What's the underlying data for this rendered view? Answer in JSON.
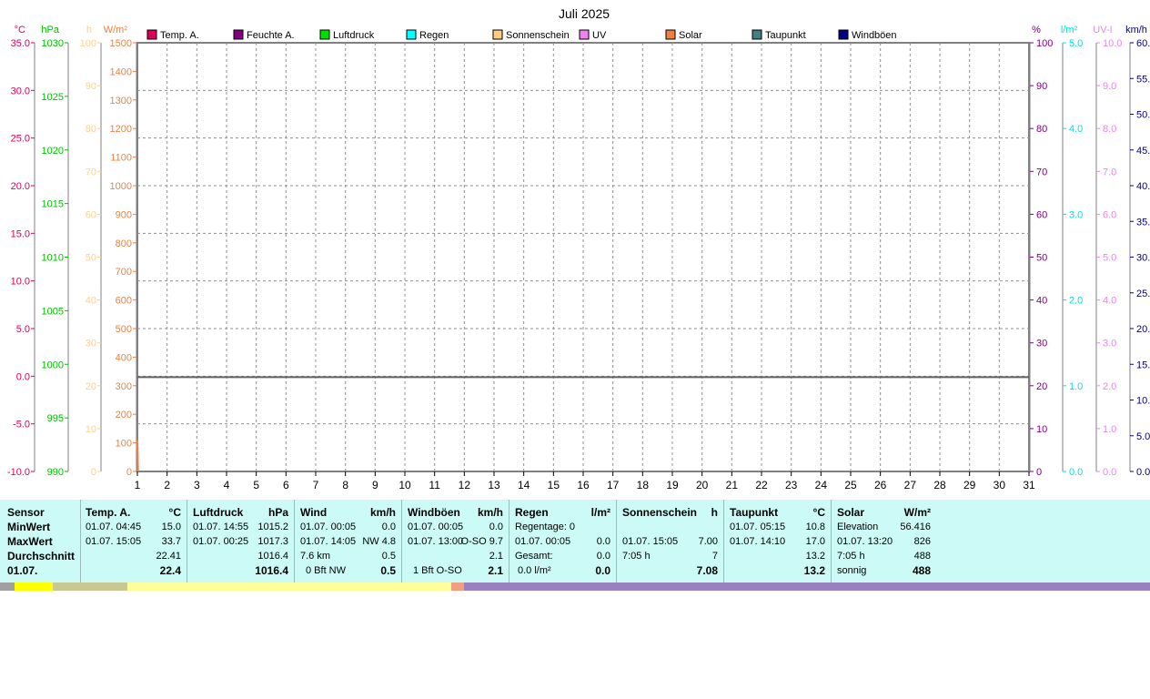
{
  "chart_data": {
    "type": "line",
    "title": "Juli 2025",
    "x": [
      1,
      2,
      3,
      4,
      5,
      6,
      7,
      8,
      9,
      10,
      11,
      12,
      13,
      14,
      15,
      16,
      17,
      18,
      19,
      20,
      21,
      22,
      23,
      24,
      25,
      26,
      27,
      28,
      29,
      30,
      31
    ],
    "xlim": [
      1,
      31
    ],
    "grid": true,
    "legend_position": "top",
    "legend": [
      {
        "name": "Temp. A.",
        "color": "#e0005a"
      },
      {
        "name": "Feuchte A.",
        "color": "#800080"
      },
      {
        "name": "Luftdruck",
        "color": "#00e000"
      },
      {
        "name": "Regen",
        "color": "#00ffff"
      },
      {
        "name": "Sonnenschein",
        "color": "#ffcc80"
      },
      {
        "name": "UV",
        "color": "#ee82ee"
      },
      {
        "name": "Solar",
        "color": "#f08040"
      },
      {
        "name": "Taupunkt",
        "color": "#408080"
      },
      {
        "name": "Windböen",
        "color": "#000080"
      }
    ],
    "axes": [
      {
        "unit": "°C",
        "color": "#e0005a",
        "side": "left",
        "min": -10,
        "max": 35,
        "step": 5,
        "decimals": 1
      },
      {
        "unit": "hPa",
        "color": "#00c000",
        "side": "left",
        "min": 990,
        "max": 1030,
        "step": 5,
        "decimals": 0
      },
      {
        "unit": "h",
        "color": "#ffd090",
        "side": "left",
        "min": 0,
        "max": 100,
        "step": 10,
        "decimals": 0
      },
      {
        "unit": "W/m²",
        "color": "#f08040",
        "side": "left",
        "min": 0,
        "max": 1500,
        "step": 100,
        "decimals": 0
      },
      {
        "unit": "%",
        "color": "#800080",
        "side": "right",
        "min": 0,
        "max": 100,
        "step": 10,
        "decimals": 0
      },
      {
        "unit": "l/m²",
        "color": "#00e0e0",
        "side": "right",
        "min": 0,
        "max": 5,
        "step": 1,
        "decimals": 1
      },
      {
        "unit": "UV-I",
        "color": "#ee82ee",
        "side": "right",
        "min": 0,
        "max": 10,
        "step": 1,
        "decimals": 1
      },
      {
        "unit": "km/h",
        "color": "#000080",
        "side": "right",
        "min": 0,
        "max": 60,
        "step": 5,
        "decimals": 1
      }
    ],
    "series": [
      {
        "name": "Solar",
        "unit": "W/m²",
        "points": [
          [
            1,
            110
          ],
          [
            1.02,
            0
          ]
        ]
      }
    ],
    "reference_value": 330
  },
  "table": {
    "sensor": {
      "header": "Sensor",
      "min": "MinWert",
      "max": "MaxWert",
      "avg": "Durchschnitt",
      "day": "01.07."
    },
    "temp": {
      "title": "Temp. A.",
      "unit": "°C",
      "min_time": "01.07.  04:45",
      "min_val": "15.0",
      "max_time": "01.07.  15:05",
      "max_val": "33.7",
      "avg": "22.41",
      "day": "22.4"
    },
    "pressure": {
      "title": "Luftdruck",
      "unit": "hPa",
      "min_time": "01.07.  14:55",
      "min_val": "1015.2",
      "max_time": "01.07.  00:25",
      "max_val": "1017.3",
      "avg": "1016.4",
      "day": "1016.4"
    },
    "wind": {
      "title": "Wind",
      "unit": "km/h",
      "min_time": "01.07.  00:05",
      "min_val": "0.0",
      "max_time": "01.07.  14:05",
      "max_val": "NW 4.8",
      "avg_label": "7.6 km",
      "avg": "0.5",
      "day_label": "0 Bft NW",
      "day": "0.5"
    },
    "gusts": {
      "title": "Windböen",
      "unit": "km/h",
      "min_time": "01.07.  00:05",
      "min_val": "0.0",
      "max_time": "01.07.  13:00",
      "max_val": "O-SO 9.7",
      "avg": "2.1",
      "day_label": "1 Bft O-SO",
      "day": "2.1"
    },
    "rain": {
      "title": "Regen",
      "unit": "l/m²",
      "min_label": "Regentage: 0",
      "max_time": "01.07.  00:05",
      "max_val": "0.0",
      "avg_label": "Gesamt:",
      "avg": "0.0",
      "day_label": "0.0 l/m²",
      "day": "0.0"
    },
    "sun": {
      "title": "Sonnenschein",
      "unit": "h",
      "max_time": "01.07.  15:05",
      "max_val": "7.00",
      "avg_label": "7:05 h",
      "avg": "7",
      "day": "7.08"
    },
    "dew": {
      "title": "Taupunkt",
      "unit": "°C",
      "min_time": "01.07.  05:15",
      "min_val": "10.8",
      "max_time": "01.07.  14:10",
      "max_val": "17.0",
      "avg": "13.2",
      "day": "13.2"
    },
    "solar": {
      "title": "Solar",
      "unit": "W/m²",
      "min_label": "Elevation",
      "min_val": "56.416",
      "max_time": "01.07.  13:20",
      "max_val": "826",
      "avg_label": "7:05 h",
      "avg": "488",
      "day_label": "sonnig",
      "day": "488"
    }
  }
}
